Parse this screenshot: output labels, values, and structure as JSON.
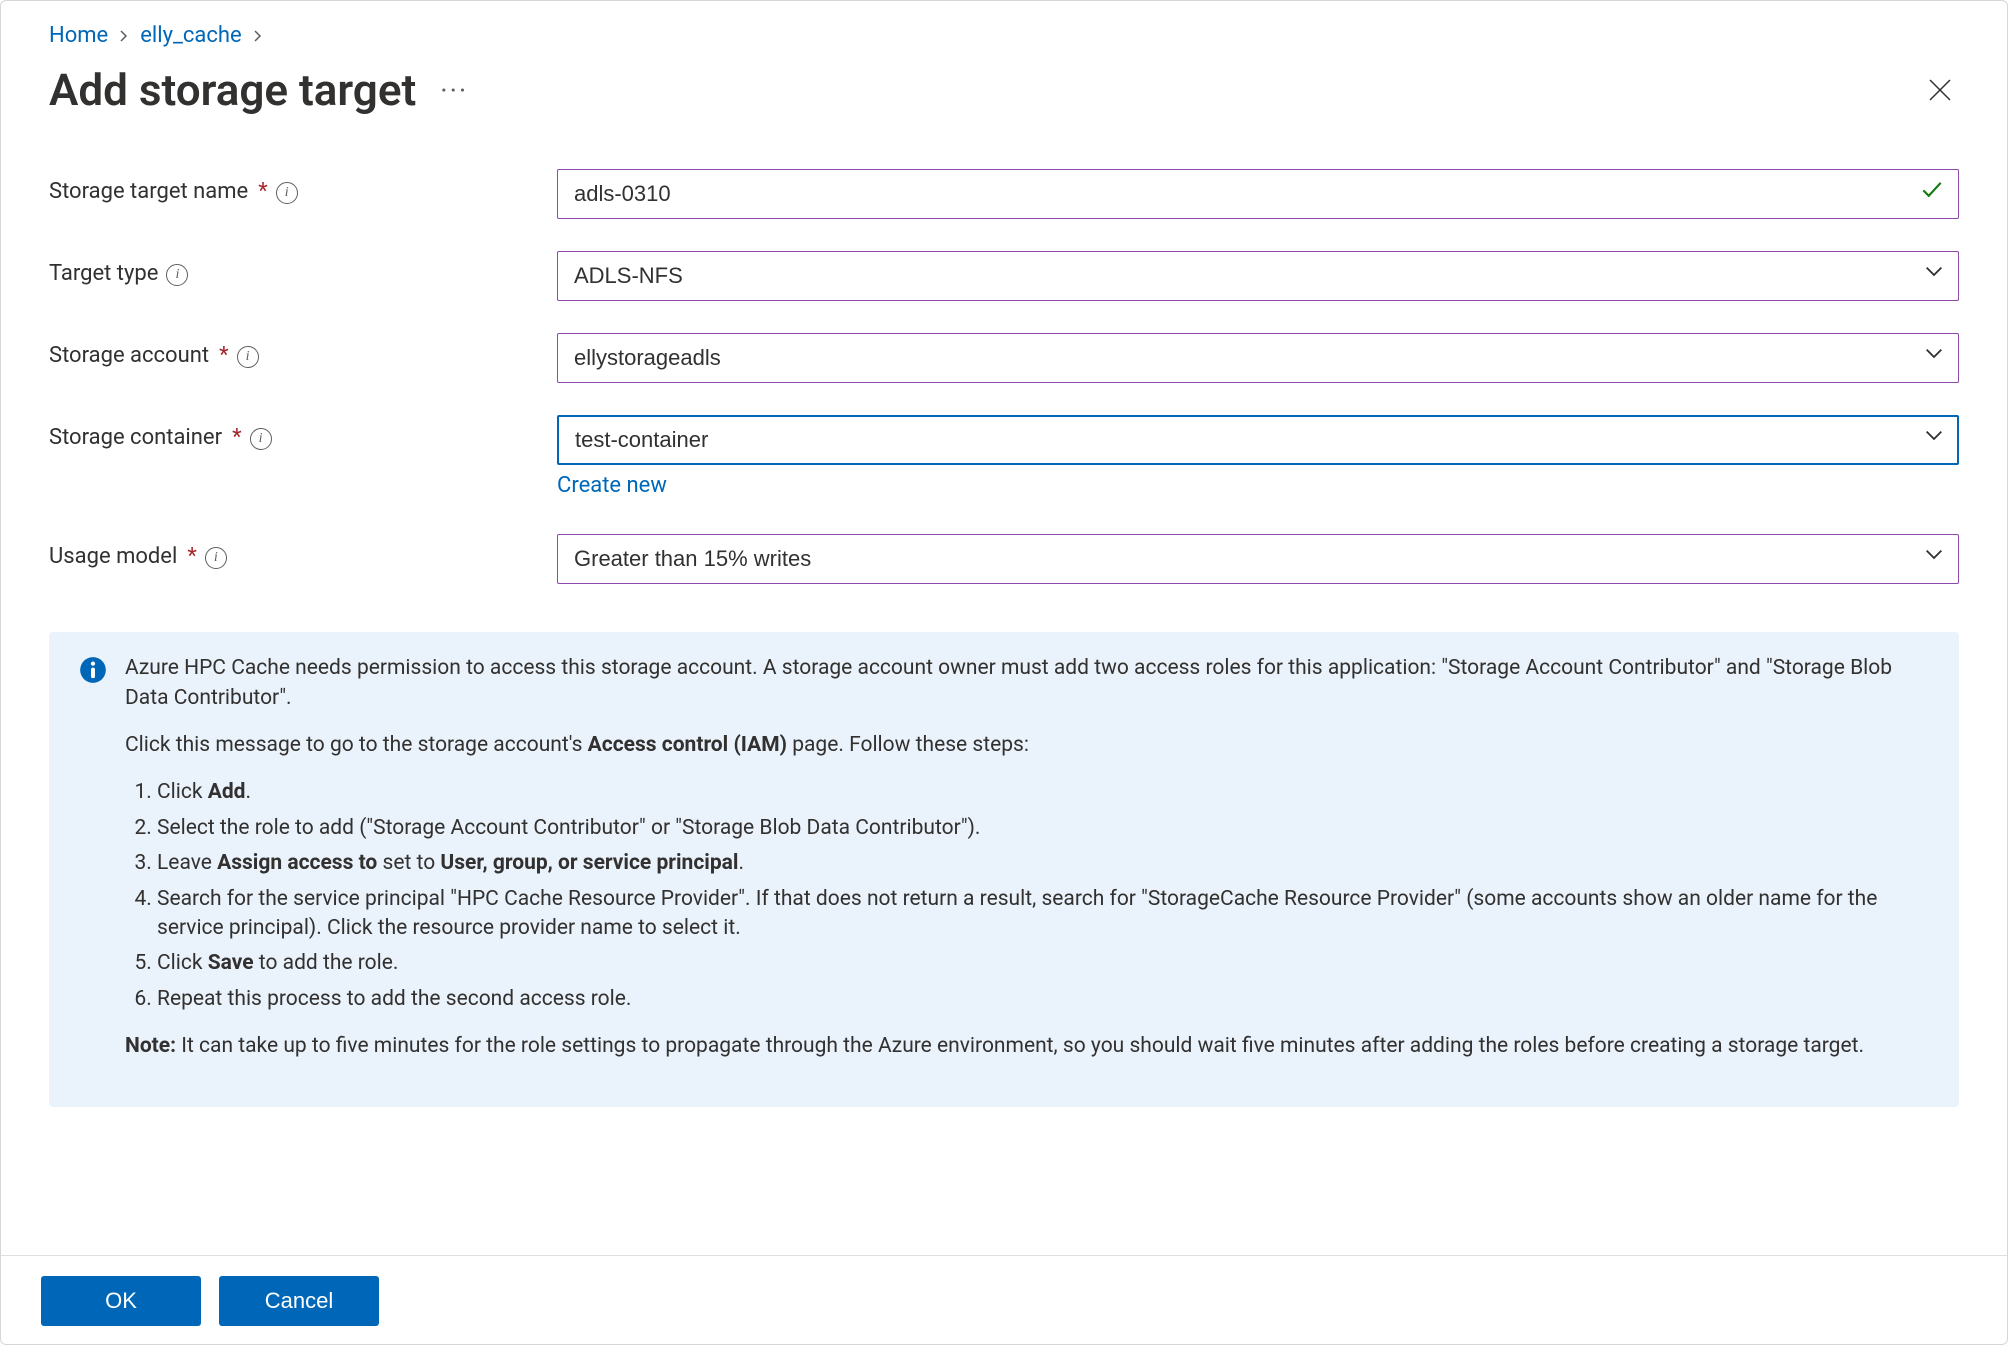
{
  "breadcrumb": {
    "home": "Home",
    "cache": "elly_cache"
  },
  "title": "Add storage target",
  "fields": {
    "name": {
      "label": "Storage target name",
      "value": "adls-0310"
    },
    "type": {
      "label": "Target type",
      "value": "ADLS-NFS"
    },
    "account": {
      "label": "Storage account",
      "value": "ellystorageadls"
    },
    "container": {
      "label": "Storage container",
      "value": "test-container",
      "create_new": "Create new"
    },
    "usage": {
      "label": "Usage model",
      "value": "Greater than 15% writes"
    }
  },
  "callout": {
    "p1a": "Azure HPC Cache needs permission to access this storage account. A storage account owner must add two access roles for this application: \"Storage Account Contributor\" and \"Storage Blob Data Contributor\".",
    "p2a": "Click this message to go to the storage account's ",
    "p2b": "Access control (IAM)",
    "p2c": " page. Follow these steps:",
    "s1a": "Click ",
    "s1b": "Add",
    "s1c": ".",
    "s2": "Select the role to add (\"Storage Account Contributor\" or \"Storage Blob Data Contributor\").",
    "s3a": "Leave ",
    "s3b": "Assign access to",
    "s3c": " set to ",
    "s3d": "User, group, or service principal",
    "s3e": ".",
    "s4": "Search for the service principal \"HPC Cache Resource Provider\". If that does not return a result, search for \"StorageCache Resource Provider\" (some accounts show an older name for the service principal). Click the resource provider name to select it.",
    "s5a": "Click ",
    "s5b": "Save",
    "s5c": " to add the role.",
    "s6": "Repeat this process to add the second access role.",
    "note_label": "Note:",
    "note_body": " It can take up to five minutes for the role settings to propagate through the Azure environment, so you should wait five minutes after adding the roles before creating a storage target."
  },
  "buttons": {
    "ok": "OK",
    "cancel": "Cancel"
  }
}
